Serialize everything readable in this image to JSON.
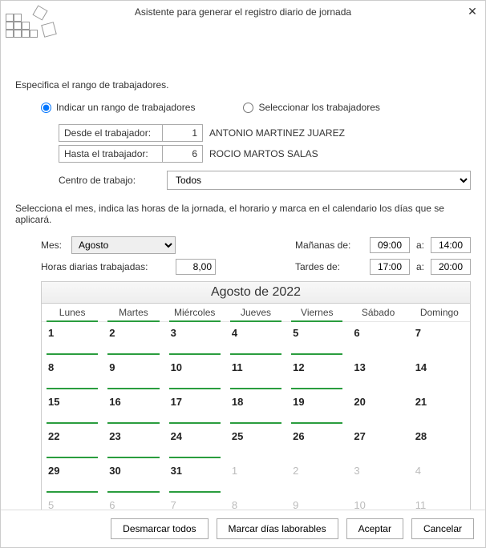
{
  "title": "Asistente para generar el registro diario de jornada",
  "section1_label": "Especifica el rango de trabajadores.",
  "radio_range": "Indicar un rango de trabajadores",
  "radio_select": "Seleccionar los trabajadores",
  "from_label": "Desde el trabajador:",
  "from_num": "1",
  "from_name": "ANTONIO MARTINEZ JUAREZ",
  "to_label": "Hasta el trabajador:",
  "to_num": "6",
  "to_name": "ROCIO MARTOS SALAS",
  "center_label": "Centro de trabajo:",
  "center_value": "Todos",
  "section2_label": "Selecciona el mes, indica las horas de la jornada, el horario y marca en el calendario los días que se aplicará.",
  "month_label": "Mes:",
  "month_value": "Agosto",
  "hours_label": "Horas diarias trabajadas:",
  "hours_value": "8,00",
  "morning_label": "Mañanas de:",
  "morning_from": "09:00",
  "a_label": "a:",
  "morning_to": "14:00",
  "afternoon_label": "Tardes de:",
  "afternoon_from": "17:00",
  "afternoon_to": "20:00",
  "calendar_title": "Agosto de 2022",
  "weekdays": [
    "Lunes",
    "Martes",
    "Miércoles",
    "Jueves",
    "Viernes",
    "Sábado",
    "Domingo"
  ],
  "weekday_marked": [
    true,
    true,
    true,
    true,
    true,
    false,
    false
  ],
  "weeks": [
    [
      {
        "d": "1",
        "m": true
      },
      {
        "d": "2",
        "m": true
      },
      {
        "d": "3",
        "m": true
      },
      {
        "d": "4",
        "m": true
      },
      {
        "d": "5",
        "m": true
      },
      {
        "d": "6",
        "m": false
      },
      {
        "d": "7",
        "m": false
      }
    ],
    [
      {
        "d": "8",
        "m": true
      },
      {
        "d": "9",
        "m": true
      },
      {
        "d": "10",
        "m": true
      },
      {
        "d": "11",
        "m": true
      },
      {
        "d": "12",
        "m": true
      },
      {
        "d": "13",
        "m": false
      },
      {
        "d": "14",
        "m": false
      }
    ],
    [
      {
        "d": "15",
        "m": true
      },
      {
        "d": "16",
        "m": true
      },
      {
        "d": "17",
        "m": true
      },
      {
        "d": "18",
        "m": true
      },
      {
        "d": "19",
        "m": true
      },
      {
        "d": "20",
        "m": false
      },
      {
        "d": "21",
        "m": false
      }
    ],
    [
      {
        "d": "22",
        "m": true
      },
      {
        "d": "23",
        "m": true
      },
      {
        "d": "24",
        "m": true
      },
      {
        "d": "25",
        "m": false
      },
      {
        "d": "26",
        "m": false
      },
      {
        "d": "27",
        "m": false
      },
      {
        "d": "28",
        "m": false
      }
    ],
    [
      {
        "d": "29",
        "m": true
      },
      {
        "d": "30",
        "m": true
      },
      {
        "d": "31",
        "m": true
      },
      {
        "d": "1",
        "m": false,
        "o": true
      },
      {
        "d": "2",
        "m": false,
        "o": true
      },
      {
        "d": "3",
        "m": false,
        "o": true
      },
      {
        "d": "4",
        "m": false,
        "o": true
      }
    ],
    [
      {
        "d": "5",
        "m": false,
        "o": true
      },
      {
        "d": "6",
        "m": false,
        "o": true
      },
      {
        "d": "7",
        "m": false,
        "o": true
      },
      {
        "d": "8",
        "m": false,
        "o": true
      },
      {
        "d": "9",
        "m": false,
        "o": true
      },
      {
        "d": "10",
        "m": false,
        "o": true
      },
      {
        "d": "11",
        "m": false,
        "o": true
      }
    ]
  ],
  "btn_unmark": "Desmarcar todos",
  "btn_mark": "Marcar días laborables",
  "btn_accept": "Aceptar",
  "btn_cancel": "Cancelar"
}
